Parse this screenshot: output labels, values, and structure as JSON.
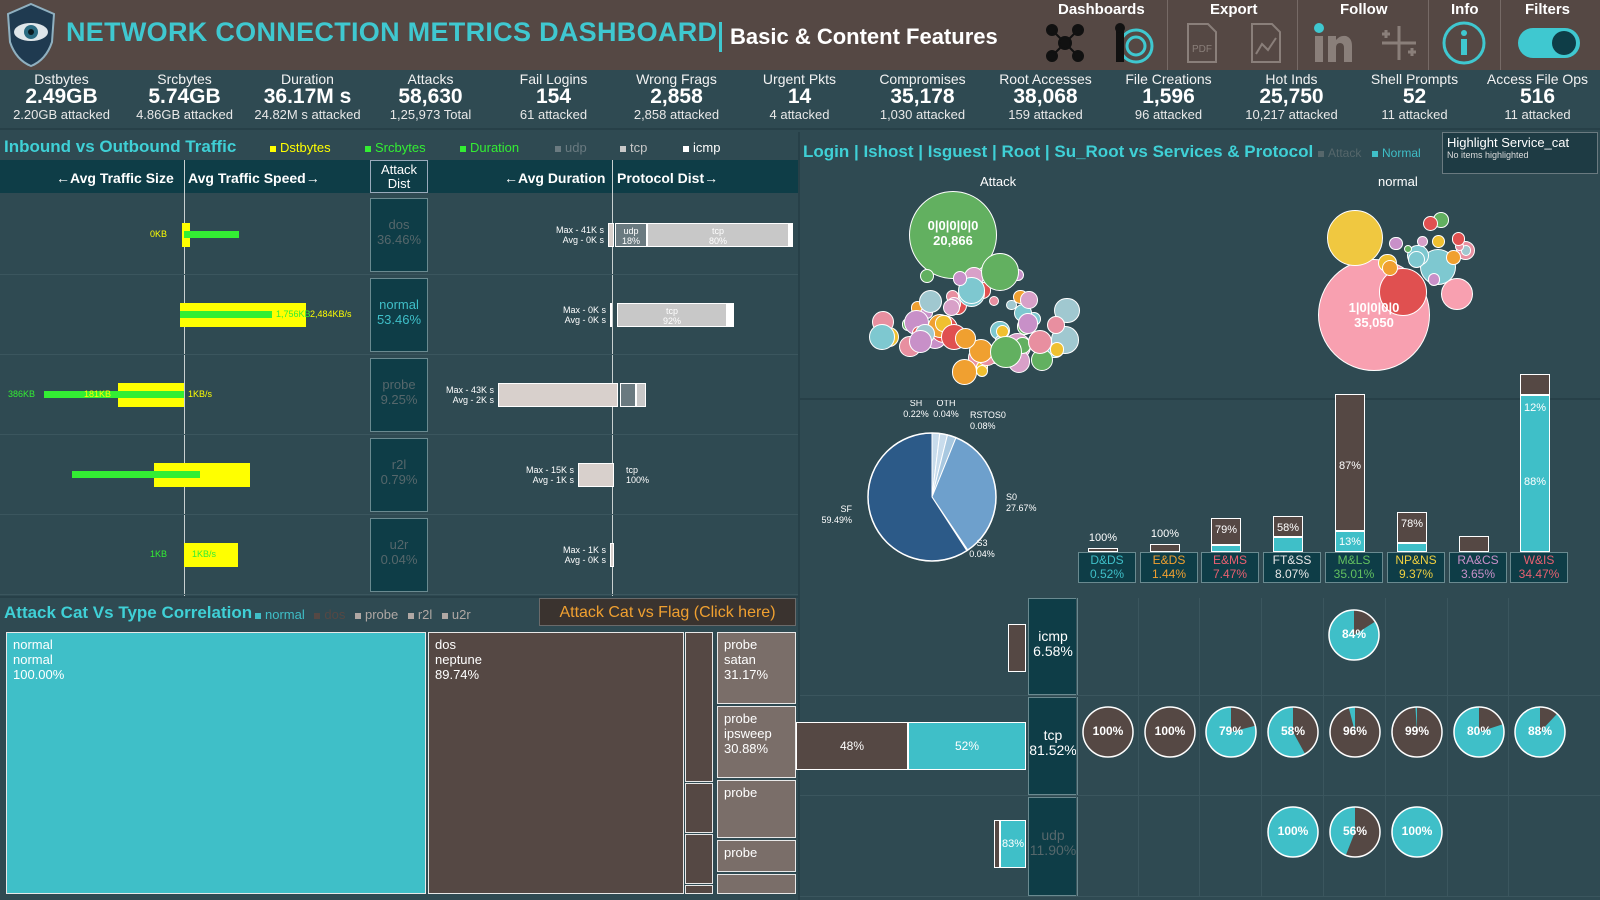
{
  "header": {
    "title": "NETWORK CONNECTION METRICS DASHBOARD",
    "subtitle": "Basic & Content Features",
    "menus": {
      "dashboards": "Dashboards",
      "export": "Export",
      "follow": "Follow",
      "info": "Info",
      "filters": "Filters"
    }
  },
  "kpis": [
    {
      "label": "Dstbytes",
      "value": "2.49GB",
      "sub": "2.20GB attacked"
    },
    {
      "label": "Srcbytes",
      "value": "5.74GB",
      "sub": "4.86GB attacked"
    },
    {
      "label": "Duration",
      "value": "36.17M s",
      "sub": "24.82M s attacked"
    },
    {
      "label": "Attacks",
      "value": "58,630",
      "sub": "1,25,973 Total"
    },
    {
      "label": "Fail Logins",
      "value": "154",
      "sub": "61 attacked"
    },
    {
      "label": "Wrong Frags",
      "value": "2,858",
      "sub": "2,858 attacked"
    },
    {
      "label": "Urgent Pkts",
      "value": "14",
      "sub": "4 attacked"
    },
    {
      "label": "Compromises",
      "value": "35,178",
      "sub": "1,030 attacked"
    },
    {
      "label": "Root Accesses",
      "value": "38,068",
      "sub": "159 attacked"
    },
    {
      "label": "File Creations",
      "value": "1,596",
      "sub": "96 attacked"
    },
    {
      "label": "Hot Inds",
      "value": "25,750",
      "sub": "10,217 attacked"
    },
    {
      "label": "Shell Prompts",
      "value": "52",
      "sub": "11 attacked"
    },
    {
      "label": "Access File Ops",
      "value": "516",
      "sub": "11 attacked"
    }
  ],
  "traffic": {
    "title": "Inbound vs Outbound Traffic",
    "legend": [
      "Dstbytes",
      "Srcbytes",
      "Duration",
      "udp",
      "tcp",
      "icmp"
    ],
    "col_size": "←Avg Traffic Size",
    "col_speed": "Avg Traffic Speed→",
    "col_attack": "Attack Dist",
    "col_duration": "←Avg Duration",
    "col_protocol": "Protocol Dist→",
    "rows": [
      {
        "name": "dos",
        "pct": "36.46%",
        "size_label": "0KB",
        "speed_label": "",
        "max": "Max - 41K s",
        "avg": "Avg - 0K s",
        "proto": [
          {
            "n": "udp",
            "p": "18%"
          },
          {
            "n": "tcp",
            "p": "80%"
          }
        ]
      },
      {
        "name": "normal",
        "pct": "53.46%",
        "size_label": "",
        "speed_label": "1,756KB",
        "speed_label2": "2,484KB/s",
        "max": "Max - 0K s",
        "avg": "Avg - 0K s",
        "proto": [
          {
            "n": "tcp",
            "p": "92%"
          }
        ]
      },
      {
        "name": "probe",
        "pct": "9.25%",
        "size_label": "386KB",
        "size_label2": "181KB",
        "speed_label": "1KB/s",
        "max": "Max - 43K s",
        "avg": "Avg - 2K s",
        "proto": []
      },
      {
        "name": "r2l",
        "pct": "0.79%",
        "size_label": "",
        "speed_label": "",
        "max": "Max - 15K s",
        "avg": "Avg - 1K s",
        "proto": [
          {
            "n": "tcp",
            "p": "100%"
          }
        ]
      },
      {
        "name": "u2r",
        "pct": "0.04%",
        "size_label": "1KB",
        "speed_label": "1KB/s",
        "max": "Max - 1K s",
        "avg": "Avg - 0K s",
        "proto": []
      }
    ]
  },
  "login": {
    "title": "Login | Ishost | Isguest | Root | Su_Root vs Services & Protocol",
    "legend": [
      "Attack",
      "Normal"
    ],
    "highlight_title": "Highlight Service_cat",
    "highlight_sub": "No items highlighted",
    "bubble_attack_title": "Attack",
    "bubble_normal_title": "normal",
    "bubble_attack_label": "0|0|0|0|0",
    "bubble_attack_value": "20,866",
    "bubble_normal_label": "1|0|0|0|0",
    "bubble_normal_value": "35,050"
  },
  "flag_pie": {
    "slices": [
      {
        "name": "SF",
        "value": "59.49%"
      },
      {
        "name": "S0",
        "value": "27.67%"
      },
      {
        "name": "S3",
        "value": "0.04%"
      },
      {
        "name": "SH",
        "value": "0.22%"
      },
      {
        "name": "OTH",
        "value": "0.04%"
      },
      {
        "name": "RSTOS0",
        "value": "0.08%"
      }
    ]
  },
  "services": [
    {
      "name": "D&DS",
      "pct": "0.52%",
      "attack": "100%",
      "color": "#3fbfc8"
    },
    {
      "name": "E&DS",
      "pct": "1.44%",
      "attack": "100%",
      "color": "#f0a030"
    },
    {
      "name": "E&MS",
      "pct": "7.47%",
      "attack": "79%",
      "color": "#e86070"
    },
    {
      "name": "FT&SS",
      "pct": "8.07%",
      "attack": "58%",
      "color": "#e8e8e8"
    },
    {
      "name": "M&LS",
      "pct": "35.01%",
      "attack": "87%",
      "normal": "13%",
      "color": "#62c060"
    },
    {
      "name": "NP&NS",
      "pct": "9.37%",
      "attack": "78%",
      "color": "#f0d040"
    },
    {
      "name": "RA&CS",
      "pct": "3.65%",
      "attack": "",
      "color": "#c890c8"
    },
    {
      "name": "W&IS",
      "pct": "34.47%",
      "attack": "12%",
      "normal": "88%",
      "color": "#e86070"
    }
  ],
  "protocols": [
    {
      "name": "icmp",
      "pct": "6.58%"
    },
    {
      "name": "tcp",
      "pct": "81.52%",
      "attack": "48%",
      "normal": "52%"
    },
    {
      "name": "udp",
      "pct": "11.90%",
      "normal": "83%"
    }
  ],
  "matrix": {
    "icmp": [
      "84%"
    ],
    "tcp": [
      "100%",
      "100%",
      "79%",
      "58%",
      "96%",
      "99%",
      "80%",
      "88%"
    ],
    "udp": [
      "100%",
      "56%",
      "100%"
    ]
  },
  "treemap": {
    "title": "Attack Cat Vs Type Correlation",
    "legend": [
      "normal",
      "dos",
      "probe",
      "r2l",
      "u2r"
    ],
    "button": "Attack Cat vs Flag (Click here)",
    "cells": [
      {
        "l1": "normal",
        "l2": "normal",
        "l3": "100.00%"
      },
      {
        "l1": "dos",
        "l2": "neptune",
        "l3": "89.74%"
      },
      {
        "l1": "probe",
        "l2": "satan",
        "l3": "31.17%"
      },
      {
        "l1": "probe",
        "l2": "ipsweep",
        "l3": "30.88%"
      },
      {
        "l1": "probe",
        "l2": "",
        "l3": ""
      },
      {
        "l1": "probe",
        "l2": "",
        "l3": ""
      }
    ]
  },
  "colors": {
    "teal": "#3fbfc8",
    "brown": "#554844",
    "yellow": "#ffff00",
    "green": "#33ee33",
    "header_title": "#3fc8d0"
  }
}
